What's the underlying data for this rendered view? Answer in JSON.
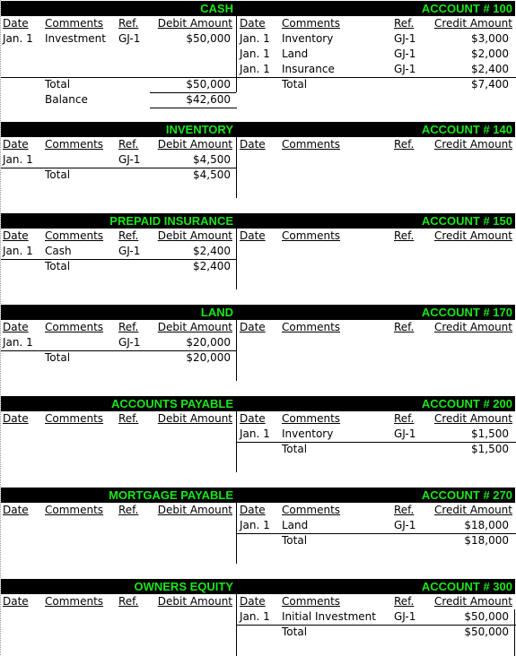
{
  "columns": {
    "left": {
      "date": "Date",
      "comments": "Comments",
      "ref": "Ref.",
      "amount": "Debit Amount"
    },
    "right": {
      "date": "Date",
      "comments": "Comments",
      "ref": "Ref.",
      "amount": "Credit Amount"
    }
  },
  "labels": {
    "total": "Total",
    "balance": "Balance"
  },
  "colors": {
    "header_bg": "#000000",
    "header_text": "#19e619"
  },
  "accounts": [
    {
      "name": "CASH",
      "account": "ACCOUNT # 100",
      "debits": [
        {
          "date": "Jan. 1",
          "comments": "Investment",
          "ref": "GJ-1",
          "amount": "$50,000"
        }
      ],
      "debit_total": "$50,000",
      "balance": "$42,600",
      "credits": [
        {
          "date": "Jan. 1",
          "comments": "Inventory",
          "ref": "GJ-1",
          "amount": "$3,000"
        },
        {
          "date": "Jan. 1",
          "comments": "Land",
          "ref": "GJ-1",
          "amount": "$2,000"
        },
        {
          "date": "Jan. 1",
          "comments": "Insurance",
          "ref": "GJ-1",
          "amount": "$2,400"
        }
      ],
      "credit_total": "$7,400"
    },
    {
      "name": "INVENTORY",
      "account": "ACCOUNT # 140",
      "debits": [
        {
          "date": "Jan. 1",
          "comments": "",
          "ref": "GJ-1",
          "amount": "$4,500"
        }
      ],
      "debit_total": "$4,500"
    },
    {
      "name": "PREPAID INSURANCE",
      "account": "ACCOUNT # 150",
      "debits": [
        {
          "date": "Jan. 1",
          "comments": "Cash",
          "ref": "GJ-1",
          "amount": "$2,400"
        }
      ],
      "debit_total": "$2,400"
    },
    {
      "name": "LAND",
      "account": "ACCOUNT # 170",
      "debits": [
        {
          "date": "Jan. 1",
          "comments": "",
          "ref": "GJ-1",
          "amount": "$20,000"
        }
      ],
      "debit_total": "$20,000"
    },
    {
      "name": "ACCOUNTS PAYABLE",
      "account": "ACCOUNT # 200",
      "credits": [
        {
          "date": "Jan. 1",
          "comments": "Inventory",
          "ref": "GJ-1",
          "amount": "$1,500"
        }
      ],
      "credit_total": "$1,500"
    },
    {
      "name": "MORTGAGE PAYABLE",
      "account": "ACCOUNT # 270",
      "credits": [
        {
          "date": "Jan. 1",
          "comments": "Land",
          "ref": "GJ-1",
          "amount": "$18,000"
        }
      ],
      "credit_total": "$18,000"
    },
    {
      "name": "OWNERS EQUITY",
      "account": "ACCOUNT # 300",
      "credits": [
        {
          "date": "Jan. 1",
          "comments": "Initial Investment",
          "ref": "GJ-1",
          "amount": "$50,000"
        }
      ],
      "credit_total": "$50,000"
    }
  ]
}
